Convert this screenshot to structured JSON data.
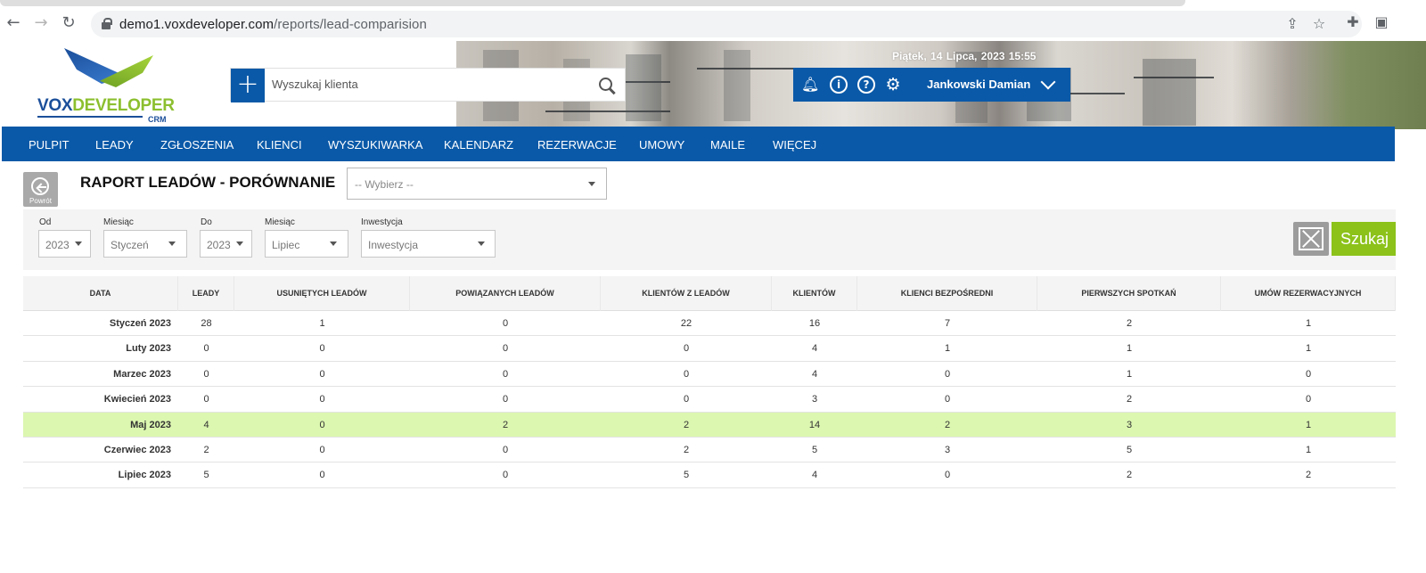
{
  "browser": {
    "url_host": "demo1.voxdeveloper.com",
    "url_path": "/reports/lead-comparision"
  },
  "header": {
    "logo": {
      "part1": "VOX",
      "part2": "DEVELOPER",
      "part3": "CRM"
    },
    "search_placeholder": "Wyszukaj klienta",
    "add_icon": "plus-icon",
    "datetime": "Piątek, 14 Lipca, 2023   15:55",
    "user_name": "Jankowski Damian"
  },
  "nav": {
    "items": [
      "PULPIT",
      "LEADY",
      "ZGŁOSZENIA",
      "KLIENCI",
      "WYSZUKIWARKA",
      "KALENDARZ",
      "REZERWACJE",
      "UMOWY",
      "MAILE",
      "WIĘCEJ"
    ]
  },
  "page": {
    "back_label": "Powrót",
    "title": "RAPORT LEADÓW - PORÓWNANIE",
    "select_placeholder": "-- Wybierz --"
  },
  "filters": {
    "od_label": "Od",
    "od_year": "2023",
    "od_month_label": "Miesiąc",
    "od_month": "Styczeń",
    "do_label": "Do",
    "do_year": "2023",
    "do_month_label": "Miesiąc",
    "do_month": "Lipiec",
    "investment_label": "Inwestycja",
    "investment_value": "Inwestycja",
    "search_button": "Szukaj"
  },
  "table": {
    "headers": [
      "DATA",
      "LEADY",
      "USUNIĘTYCH LEADÓW",
      "POWIĄZANYCH LEADÓW",
      "KLIENTÓW Z LEADÓW",
      "KLIENTÓW",
      "KLIENCI BEZPOŚREDNI",
      "PIERWSZYCH SPOTKAŃ",
      "UMÓW REZERWACYJNYCH"
    ],
    "rows": [
      [
        "Styczeń 2023",
        "28",
        "1",
        "0",
        "22",
        "16",
        "7",
        "2",
        "1"
      ],
      [
        "Luty 2023",
        "0",
        "0",
        "0",
        "0",
        "4",
        "1",
        "1",
        "1"
      ],
      [
        "Marzec 2023",
        "0",
        "0",
        "0",
        "0",
        "4",
        "0",
        "1",
        "0"
      ],
      [
        "Kwiecień 2023",
        "0",
        "0",
        "0",
        "0",
        "3",
        "0",
        "2",
        "0"
      ],
      [
        "Maj 2023",
        "4",
        "0",
        "2",
        "2",
        "14",
        "2",
        "3",
        "1"
      ],
      [
        "Czerwiec 2023",
        "2",
        "0",
        "0",
        "2",
        "5",
        "3",
        "5",
        "1"
      ],
      [
        "Lipiec 2023",
        "5",
        "0",
        "0",
        "5",
        "4",
        "0",
        "2",
        "2"
      ]
    ],
    "highlight_color": "#dcf7b0"
  },
  "colors": {
    "brand_blue": "#0a59a8",
    "search_green": "#8cc21a"
  }
}
